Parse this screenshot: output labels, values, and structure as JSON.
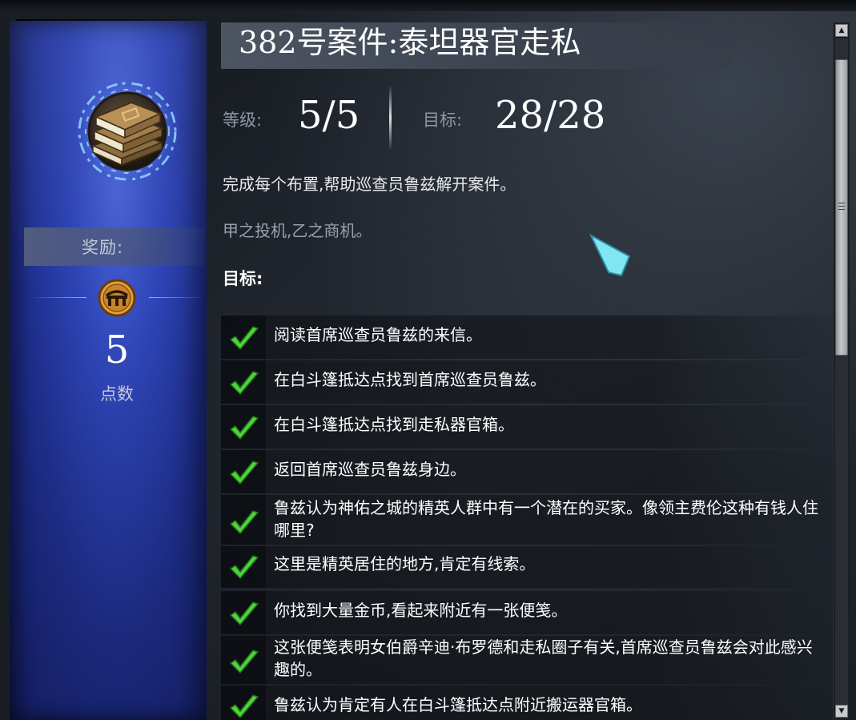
{
  "quest": {
    "title": "382号案件:泰坦器官走私",
    "level_label": "等级:",
    "level_value": "5/5",
    "target_label": "目标:",
    "target_value": "28/28",
    "description": "完成每个布置,帮助巡查员鲁兹解开案件。",
    "flavor": "甲之投机,乙之商机。",
    "goals_heading": "目标:"
  },
  "reward": {
    "label": "奖励:",
    "icon": "bridge-coin-icon",
    "points_value": "5",
    "points_label": "点数"
  },
  "goals": [
    {
      "text": "阅读首席巡查员鲁兹的来信。",
      "done": true
    },
    {
      "text": "在白斗篷抵达点找到首席巡查员鲁兹。",
      "done": true
    },
    {
      "text": "在白斗篷抵达点找到走私器官箱。",
      "done": true
    },
    {
      "text": "返回首席巡查员鲁兹身边。",
      "done": true
    },
    {
      "text": "鲁兹认为神佑之城的精英人群中有一个潜在的买家。像领主费伦这种有钱人住哪里?",
      "done": true
    },
    {
      "text": "这里是精英居住的地方,肯定有线索。",
      "done": true
    },
    {
      "text": "你找到大量金币,看起来附近有一张便笺。",
      "done": true
    },
    {
      "text": "这张便笺表明女伯爵辛迪·布罗德和走私圈子有关,首席巡查员鲁兹会对此感兴趣的。",
      "done": true
    },
    {
      "text": "鲁兹认为肯定有人在白斗篷抵达点附近搬运器官箱。",
      "done": true
    }
  ],
  "colors": {
    "accent_blue": "#2e44b6",
    "check_green": "#4cd43a",
    "cursor_cyan": "#7fe6f2",
    "coin_gold": "#e2a13a"
  }
}
